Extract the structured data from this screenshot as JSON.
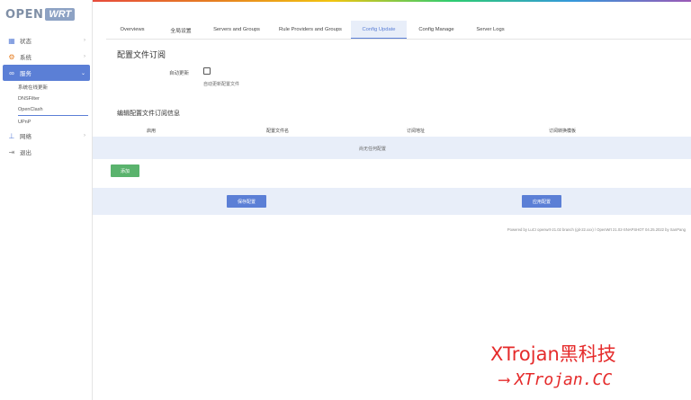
{
  "brand": {
    "open": "OPEN",
    "wrt": "WRT"
  },
  "sidebar": {
    "items": [
      {
        "label": "状态",
        "icon": "dashboard-icon"
      },
      {
        "label": "系统",
        "icon": "gear-icon"
      },
      {
        "label": "服务",
        "icon": "link-icon"
      },
      {
        "label": "网络",
        "icon": "network-icon"
      },
      {
        "label": "退出",
        "icon": "logout-icon"
      }
    ],
    "subitems": [
      "系统在线更新",
      "DNSFilter",
      "OpenClash",
      "UPnP"
    ]
  },
  "tabs": [
    "Overviews",
    "全局设置",
    "Servers and Groups",
    "Rule Providers and Groups",
    "Config Update",
    "Config Manage",
    "Server Logs"
  ],
  "page": {
    "title": "配置文件订阅",
    "auto_update_label": "自动更新",
    "auto_update_desc": "自动更新配置文件",
    "section_title": "编辑配置文件订阅信息"
  },
  "table": {
    "headers": [
      "启用",
      "配置文件名",
      "订阅地址",
      "订阅转换模板"
    ],
    "empty_text": "尚无任何配置"
  },
  "buttons": {
    "add": "添加",
    "save": "保存配置",
    "apply": "应用配置"
  },
  "footer": "Powered by LuCI openwrt-21.02 branch (git-22.xxx) / OpenWrt 21.02-SNAPSHOT 04.25.2022 by SanPang",
  "watermark": {
    "line1": "XTrojan黑科技",
    "line2": "XTrojan.CC",
    "arrow": "⟶"
  },
  "colors": {
    "accent": "#5b7fd6",
    "success": "#5ab36d",
    "watermark": "#e52b2b"
  }
}
